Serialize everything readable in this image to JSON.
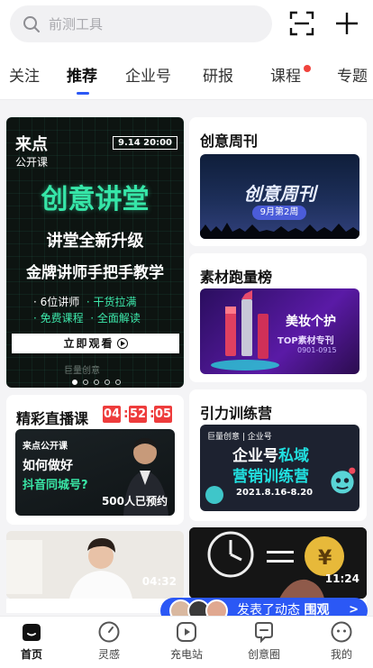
{
  "search": {
    "placeholder": "前测工具"
  },
  "tabs": [
    {
      "label": "关注"
    },
    {
      "label": "推荐"
    },
    {
      "label": "企业号"
    },
    {
      "label": "研报"
    },
    {
      "label": "课程"
    },
    {
      "label": "专题"
    }
  ],
  "banner": {
    "logo_line1": "来点",
    "logo_line2": "公开课",
    "date": "9.14 20:00",
    "headline": "创意讲堂",
    "line1": "讲堂全新升级",
    "line2": "金牌讲师手把手教学",
    "point1a": "· 6位讲师",
    "point1b": "· 干货拉满",
    "point2a": "· 免费课程",
    "point2b": "· 全面解读",
    "cta": "立即观看",
    "footer": "巨量创意",
    "slides": 5,
    "current_slide": 1
  },
  "cards": {
    "weekly": {
      "title": "创意周刊",
      "image_title": "创意周刊",
      "image_pill": "9月第2周"
    },
    "ranking": {
      "title": "素材跑量榜",
      "image_line1": "美妆个护",
      "image_line2": "TOP素材专刊",
      "image_line3": "0901-0915"
    },
    "camp": {
      "title": "引力训练营",
      "brand": "巨量创意 | 企业号",
      "image_line1a": "企业号",
      "image_line1b": "私域",
      "image_line2": "营销训练营",
      "image_dates": "2021.8.16-8.20"
    },
    "live": {
      "title": "精彩直播课",
      "timer": [
        "04",
        "52",
        "05"
      ],
      "logo": "来点公开课",
      "q1": "如何做好",
      "q2": "抖音同城号?",
      "count": "500人已预约"
    }
  },
  "videos": [
    {
      "duration": "04:32"
    },
    {
      "duration": "11:24"
    }
  ],
  "notification": {
    "text": "发表了动态",
    "action": "围观",
    "arrow": ">"
  },
  "nav": [
    {
      "label": "首页",
      "icon": "home-icon"
    },
    {
      "label": "灵感",
      "icon": "compass-icon"
    },
    {
      "label": "充电站",
      "icon": "play-icon"
    },
    {
      "label": "创意圈",
      "icon": "chat-icon"
    },
    {
      "label": "我的",
      "icon": "profile-icon"
    }
  ]
}
